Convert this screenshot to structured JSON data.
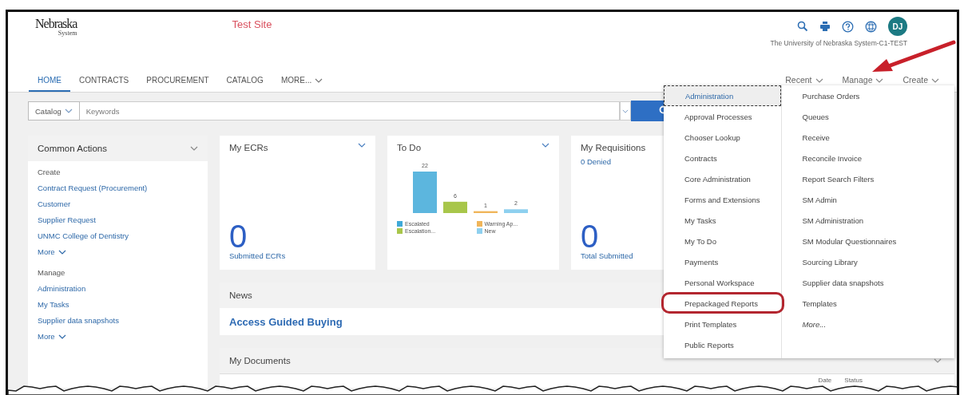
{
  "header": {
    "logo": "Nebraska",
    "logo_sub": "System",
    "site_label": "Test Site",
    "avatar": "DJ",
    "organization": "The University of Nebraska System-C1-TEST"
  },
  "nav": {
    "tabs": [
      {
        "label": "HOME",
        "selected": true
      },
      {
        "label": "CONTRACTS",
        "selected": false
      },
      {
        "label": "PROCUREMENT",
        "selected": false
      },
      {
        "label": "CATALOG",
        "selected": false
      },
      {
        "label": "MORE...",
        "selected": false
      }
    ],
    "menus": [
      "Recent",
      "Manage",
      "Create"
    ]
  },
  "search": {
    "scope": "Catalog",
    "placeholder": "Keywords"
  },
  "common_actions": {
    "title": "Common Actions",
    "sections": [
      {
        "heading": "Create",
        "links": [
          "Contract Request (Procurement)",
          "Customer",
          "Supplier Request",
          "UNMC College of Dentistry"
        ],
        "more": "More"
      },
      {
        "heading": "Manage",
        "links": [
          "Administration",
          "My Tasks",
          "Supplier data snapshots"
        ],
        "more": "More"
      }
    ]
  },
  "tiles": [
    {
      "kind": "count",
      "title": "My ECRs",
      "count": "0",
      "caption": "Submitted ECRs"
    },
    {
      "kind": "chart",
      "title": "To Do",
      "chart_data": {
        "type": "bar",
        "data_labels": true,
        "series": [
          {
            "name": "Escalated",
            "color": "#3fa9d8",
            "values": [
              22
            ]
          },
          {
            "name": "Escalation...",
            "color": "#a8c64a",
            "values": [
              6
            ]
          },
          {
            "name": "Warning Ap...",
            "color": "#f0b55a",
            "values": [
              1
            ]
          },
          {
            "name": "New",
            "color": "#8ed0ef",
            "values": [
              2
            ]
          }
        ]
      }
    },
    {
      "kind": "count",
      "title": "My Requisitions",
      "subtitle": "0 Denied",
      "count": "0",
      "caption": "Total Submitted"
    }
  ],
  "news": {
    "title": "News",
    "item": "Access Guided Buying"
  },
  "documents": {
    "title": "My Documents",
    "columns": [
      "Date",
      "Status"
    ]
  },
  "manage_menu": {
    "columns": [
      [
        {
          "label": "Administration",
          "selected": true,
          "highlighted": false
        },
        {
          "label": "Approval Processes",
          "selected": false,
          "highlighted": false
        },
        {
          "label": "Chooser Lookup",
          "selected": false,
          "highlighted": false
        },
        {
          "label": "Contracts",
          "selected": false,
          "highlighted": false
        },
        {
          "label": "Core Administration",
          "selected": false,
          "highlighted": false
        },
        {
          "label": "Forms and Extensions",
          "selected": false,
          "highlighted": false
        },
        {
          "label": "My Tasks",
          "selected": false,
          "highlighted": false
        },
        {
          "label": "My To Do",
          "selected": false,
          "highlighted": false
        },
        {
          "label": "Payments",
          "selected": false,
          "highlighted": false
        },
        {
          "label": "Personal Workspace",
          "selected": false,
          "highlighted": false
        },
        {
          "label": "Prepackaged Reports",
          "selected": false,
          "highlighted": true
        },
        {
          "label": "Print Templates",
          "selected": false,
          "highlighted": false
        },
        {
          "label": "Public Reports",
          "selected": false,
          "highlighted": false
        }
      ],
      [
        {
          "label": "Purchase Orders",
          "selected": false,
          "highlighted": false,
          "kind": "item"
        },
        {
          "label": "Queues",
          "selected": false,
          "highlighted": false,
          "kind": "item"
        },
        {
          "label": "Receive",
          "selected": false,
          "highlighted": false,
          "kind": "item"
        },
        {
          "label": "Reconcile Invoice",
          "selected": false,
          "highlighted": false,
          "kind": "item"
        },
        {
          "label": "Report Search Filters",
          "selected": false,
          "highlighted": false,
          "kind": "item"
        },
        {
          "label": "SM Admin",
          "selected": false,
          "highlighted": false,
          "kind": "item"
        },
        {
          "label": "SM Administration",
          "selected": false,
          "highlighted": false,
          "kind": "item"
        },
        {
          "label": "SM Modular Questionnaires",
          "selected": false,
          "highlighted": false,
          "kind": "item"
        },
        {
          "label": "Sourcing Library",
          "selected": false,
          "highlighted": false,
          "kind": "item"
        },
        {
          "label": "Supplier data snapshots",
          "selected": false,
          "highlighted": false,
          "kind": "item"
        },
        {
          "label": "Templates",
          "selected": false,
          "highlighted": false,
          "kind": "item"
        },
        {
          "label": "More...",
          "selected": false,
          "highlighted": false,
          "kind": "more"
        }
      ]
    ]
  }
}
